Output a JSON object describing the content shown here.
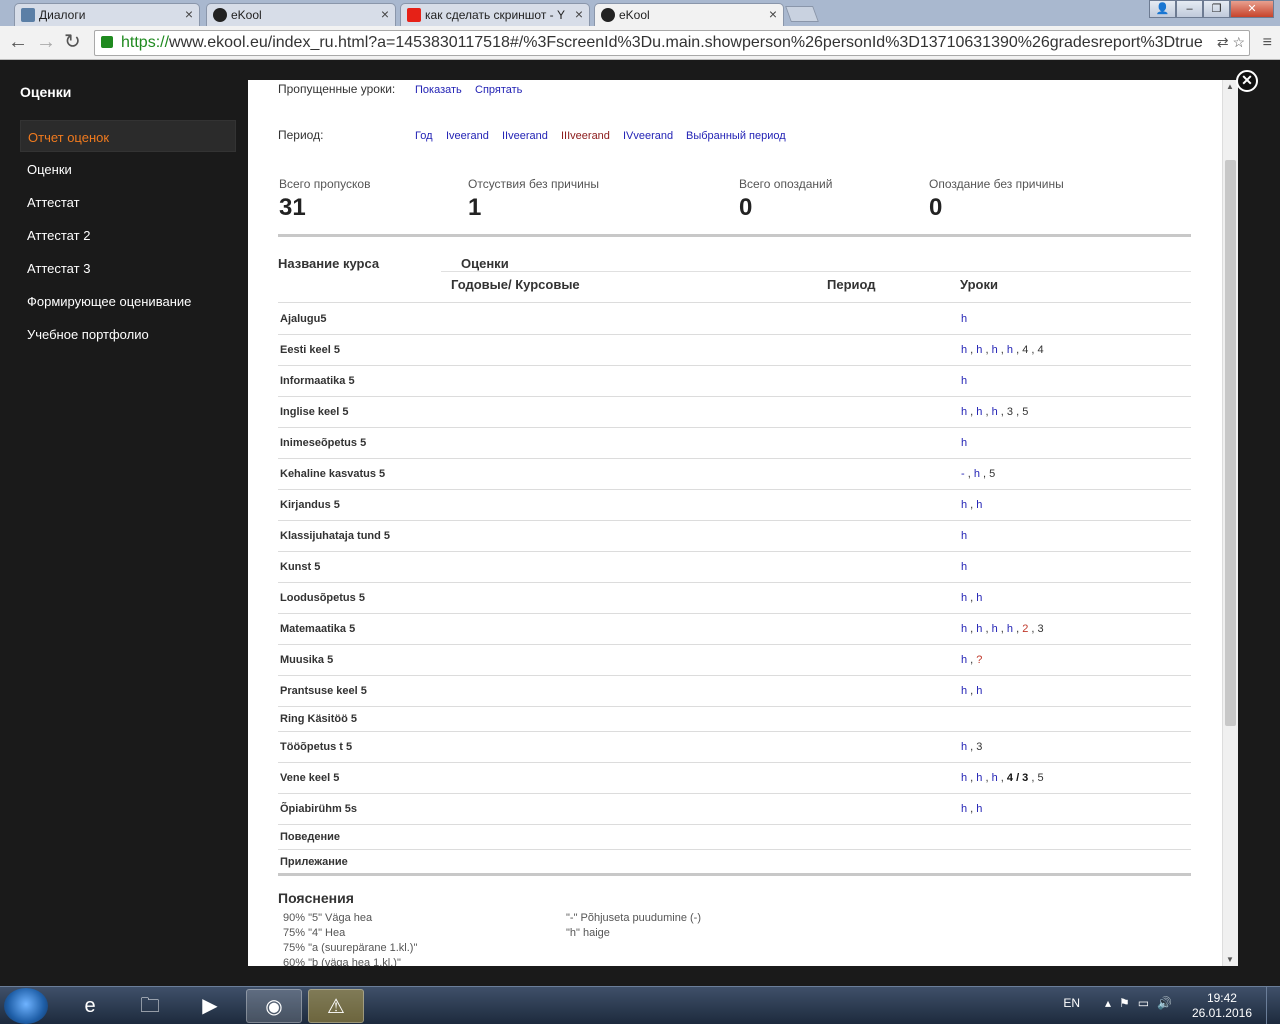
{
  "browser": {
    "tabs": [
      {
        "label": "Диалоги",
        "icon": "vk-icon"
      },
      {
        "label": "eKool",
        "icon": "owl-icon"
      },
      {
        "label": "как сделать скриншот - Y",
        "icon": "youtube-icon"
      },
      {
        "label": "eKool",
        "icon": "owl-icon"
      }
    ],
    "url_scheme": "https://",
    "url_rest": "www.ekool.eu/index_ru.html?a=1453830117518#/%3FscreenId%3Du.main.showperson%26personId%3D13710631390%26gradesreport%3Dtrue"
  },
  "sidebar": {
    "title": "Оценки",
    "items": [
      {
        "label": "Отчет оценок"
      },
      {
        "label": "Оценки"
      },
      {
        "label": "Аттестат"
      },
      {
        "label": "Аттестат 2"
      },
      {
        "label": "Аттестат 3"
      },
      {
        "label": "Формирующее оценивание"
      },
      {
        "label": "Учебное портфолио"
      }
    ]
  },
  "main": {
    "missed_label": "Пропущенные уроки:",
    "show_link": "Показать",
    "hide_link": "Спрятать",
    "period_label": "Период:",
    "periods": [
      "Год",
      "Iveerand",
      "IIveerand",
      "IIIveerand",
      "IVveerand",
      "Выбранный период"
    ],
    "stats": [
      {
        "label": "Всего пропусков",
        "value": "31"
      },
      {
        "label": "Отсуствия без причины",
        "value": "1"
      },
      {
        "label": "Всего опозданий",
        "value": "0"
      },
      {
        "label": "Опоздание без причины",
        "value": "0"
      }
    ],
    "table": {
      "col_course": "Название курса",
      "col_grades": "Оценки",
      "col_yearly": "Годовые/ Курсовые",
      "col_period": "Период",
      "col_lessons": "Уроки",
      "rows": [
        {
          "name": "Ajalugu5",
          "grades": "h"
        },
        {
          "name": "Eesti keel 5",
          "grades": "h , h , h , h , 4 , 4"
        },
        {
          "name": "Informaatika 5",
          "grades": "h"
        },
        {
          "name": "Inglise keel 5",
          "grades": "h , h , h , 3 , 5"
        },
        {
          "name": "Inimeseõpetus 5",
          "grades": "h"
        },
        {
          "name": "Kehaline kasvatus 5",
          "grades": "- , h , 5"
        },
        {
          "name": "Kirjandus 5",
          "grades": "h , h"
        },
        {
          "name": "Klassijuhataja tund 5",
          "grades": "h"
        },
        {
          "name": "Kunst 5",
          "grades": "h"
        },
        {
          "name": "Loodusõpetus 5",
          "grades": "h , h"
        },
        {
          "name": "Matemaatika 5",
          "grades": "h , h , h , h , 2 , 3"
        },
        {
          "name": "Muusika 5",
          "grades": "h , ?"
        },
        {
          "name": "Prantsuse keel 5",
          "grades": "h , h"
        },
        {
          "name": "Ring Käsitöö 5",
          "grades": ""
        },
        {
          "name": "Tööõpetus t 5",
          "grades": "h , 3"
        },
        {
          "name": "Vene keel 5",
          "grades": "h , h , h , 4 / 3 , 5"
        },
        {
          "name": "Õpiabirühm 5s",
          "grades": "h , h"
        },
        {
          "name": "Поведение",
          "grades": ""
        },
        {
          "name": "Прилежание",
          "grades": ""
        }
      ]
    },
    "legend": {
      "title": "Пояснения",
      "left": [
        "90% \"5\"  Väga hea",
        "75% \"4\"  Hea",
        "75% \"a (suurepärane 1.kl.)\"",
        "60% \"b (väga hea 1.kl.)\""
      ],
      "right": [
        "\"-\"  Põhjuseta puudumine (-)",
        "\"h\"  haige"
      ]
    }
  },
  "taskbar": {
    "lang": "EN",
    "time": "19:42",
    "date": "26.01.2016"
  },
  "colors": {
    "sidebar_bg": "#1a1a1a",
    "sidebar_active": "#f07a1e",
    "link": "#2323b5",
    "grade_red": "#c0392b"
  }
}
